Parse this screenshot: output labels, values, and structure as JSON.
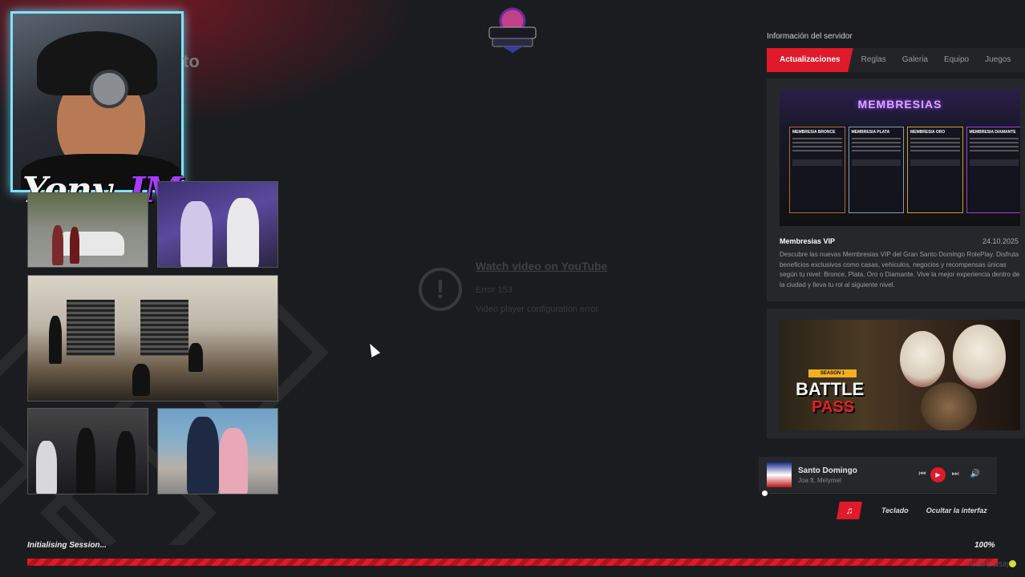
{
  "stream_overlay": {
    "streamer_name_main": "Yony_",
    "streamer_name_accent": "JM",
    "faded_title": "to"
  },
  "video_embed": {
    "link_text": "Watch video on YouTube",
    "error_code": "Error 153",
    "error_message": "Video player configuration error"
  },
  "server_info": {
    "title": "Información del servidor",
    "tabs": [
      "Actualizaciones",
      "Reglas",
      "Galeria",
      "Equipo",
      "Juegos"
    ],
    "active_tab": "Actualizaciones",
    "news": [
      {
        "banner_title": "MEMBRESIAS",
        "columns": [
          "MEMBRESIA BRONCE",
          "MEMBRESIA PLATA",
          "MEMBRESIA ORO",
          "MEMBRESIA DIAMANTE"
        ],
        "title": "Membresias VIP",
        "date": "24.10.2025",
        "description": "Descubre las nuevas Membresias VIP del Gran Santo Domingo RolePlay. Disfruta beneficios exclusivos como casas, vehiculos, negocios y recompensas únicas según tu nivel: Bronce, Plata, Oro o Diamante. Vive la mejor experiencia dentro de la ciudad y lleva tu rol al siguiente nivel."
      },
      {
        "banner_season": "SEASON 1",
        "banner_line1": "BATTLE",
        "banner_line2": "PASS"
      }
    ]
  },
  "music_player": {
    "song_title": "Santo Domingo",
    "artist": "Joa ft. Melymel",
    "progress_fraction": 0.0
  },
  "utility_bar": {
    "keyboard_label": "Teclado",
    "hide_ui_label": "Ocultar la interfaz"
  },
  "loading": {
    "status_text": "Initialising Session...",
    "percent_text": "100%",
    "progress_fraction": 1.0,
    "client_label": "FiveM (b3258)"
  },
  "colors": {
    "accent": "#e01a2a",
    "background": "#1b1c1f",
    "panel": "#26272b",
    "webcam_border": "#7fe3ff"
  }
}
